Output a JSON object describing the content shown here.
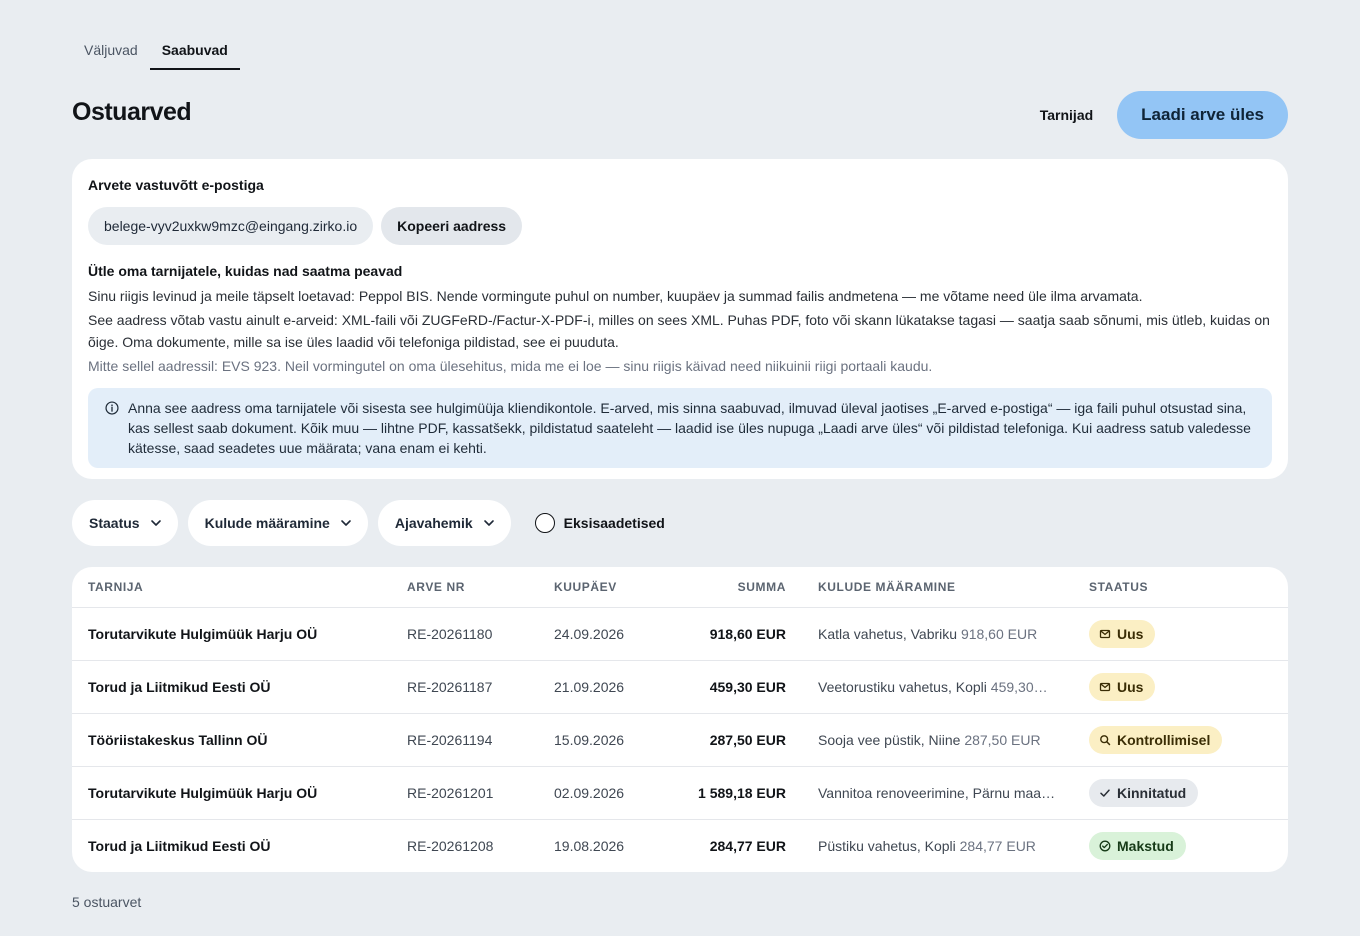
{
  "tabs": [
    {
      "label": "Väljuvad",
      "active": false
    },
    {
      "label": "Saabuvad",
      "active": true
    }
  ],
  "header": {
    "title": "Ostuarved",
    "suppliers_label": "Tarnijad",
    "upload_label": "Laadi arve üles"
  },
  "email_card": {
    "heading": "Arvete vastuvõtt e-postiga",
    "address": "belege-vyv2uxkw9mzc@eingang.zirko.io",
    "copy_label": "Kopeeri aadress",
    "subheading": "Ütle oma tarnijatele, kuidas nad saatma peavad",
    "p1": "Sinu riigis levinud ja meile täpselt loetavad: Peppol BIS. Nende vormingute puhul on number, kuupäev ja summad failis andmetena — me võtame need üle ilma arvamata.",
    "p2": "See aadress võtab vastu ainult e-arveid: XML-faili või ZUGFeRD-/Factur-X-PDF-i, milles on sees XML. Puhas PDF, foto või skann lükatakse tagasi — saatja saab sõnumi, mis ütleb, kuidas on õige. Oma dokumente, mille sa ise üles laadid või telefoniga pildistad, see ei puuduta.",
    "p3": "Mitte sellel aadressil: EVS 923. Neil vormingutel on oma ülesehitus, mida me ei loe — sinu riigis käivad need niikuinii riigi portaali kaudu.",
    "info": "Anna see aadress oma tarnijatele või sisesta see hulgimüüja kliendikontole. E-arved, mis sinna saabuvad, ilmuvad üleval jaotises „E-arved e-postiga“ — iga faili puhul otsustad sina, kas sellest saab dokument. Kõik muu — lihtne PDF, kassatšekk, pildistatud saateleht — laadid ise üles nupuga „Laadi arve üles“ või pildistad telefoniga. Kui aadress satub valedesse kätesse, saad seadetes uue määrata; vana enam ei kehti."
  },
  "filters": {
    "status": "Staatus",
    "cost": "Kulude määramine",
    "period": "Ajavahemik",
    "missent": "Eksisaadetised"
  },
  "table": {
    "headers": {
      "supplier": "TARNIJA",
      "invoice_no": "ARVE NR",
      "date": "KUUPÄEV",
      "amount": "SUMMA",
      "cost": "KULUDE MÄÄRAMINE",
      "status": "STAATUS"
    },
    "rows": [
      {
        "supplier": "Torutarvikute Hulgimüük Harju OÜ",
        "invoice_no": "RE-20261180",
        "date": "24.09.2026",
        "amount": "918,60 EUR",
        "cost": "Katla vahetus, Vabriku",
        "cost_amount": "918,60 EUR",
        "status": "Uus",
        "status_icon": "mail-icon"
      },
      {
        "supplier": "Torud ja Liitmikud Eesti OÜ",
        "invoice_no": "RE-20261187",
        "date": "21.09.2026",
        "amount": "459,30 EUR",
        "cost": "Veetorustiku vahetus, Kopli",
        "cost_amount": "459,30…",
        "status": "Uus",
        "status_icon": "mail-icon"
      },
      {
        "supplier": "Tööriistakeskus Tallinn OÜ",
        "invoice_no": "RE-20261194",
        "date": "15.09.2026",
        "amount": "287,50 EUR",
        "cost": "Sooja vee püstik, Niine",
        "cost_amount": "287,50 EUR",
        "status": "Kontrollimisel",
        "status_icon": "search-icon"
      },
      {
        "supplier": "Torutarvikute Hulgimüük Harju OÜ",
        "invoice_no": "RE-20261201",
        "date": "02.09.2026",
        "amount": "1 589,18 EUR",
        "cost": "Vannitoa renoveerimine, Pärnu maa…",
        "cost_amount": "",
        "status": "Kinnitatud",
        "status_icon": "check-icon"
      },
      {
        "supplier": "Torud ja Liitmikud Eesti OÜ",
        "invoice_no": "RE-20261208",
        "date": "19.08.2026",
        "amount": "284,77 EUR",
        "cost": "Püstiku vahetus, Kopli",
        "cost_amount": "284,77 EUR",
        "status": "Makstud",
        "status_icon": "check-circle-icon"
      }
    ]
  },
  "footer": {
    "count": "5 ostuarvet"
  }
}
